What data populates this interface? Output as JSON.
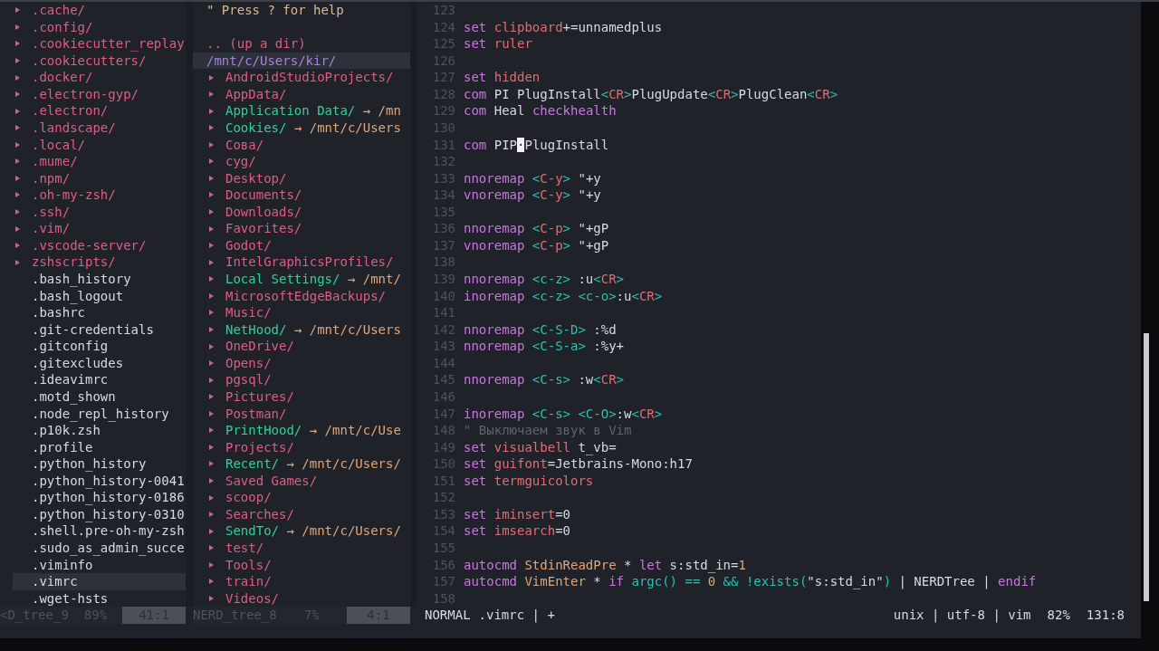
{
  "left_tree": {
    "items": [
      {
        "name": ".cache/",
        "kind": "dir",
        "selected": false
      },
      {
        "name": ".config/",
        "kind": "dir",
        "selected": false
      },
      {
        "name": ".cookiecutter_replay",
        "kind": "dir",
        "selected": false
      },
      {
        "name": ".cookiecutters/",
        "kind": "dir",
        "selected": false
      },
      {
        "name": ".docker/",
        "kind": "dir",
        "selected": false
      },
      {
        "name": ".electron-gyp/",
        "kind": "dir",
        "selected": false
      },
      {
        "name": ".electron/",
        "kind": "dir",
        "selected": false
      },
      {
        "name": ".landscape/",
        "kind": "dir",
        "selected": false
      },
      {
        "name": ".local/",
        "kind": "dir",
        "selected": false
      },
      {
        "name": ".mume/",
        "kind": "dir",
        "selected": false
      },
      {
        "name": ".npm/",
        "kind": "dir",
        "selected": false
      },
      {
        "name": ".oh-my-zsh/",
        "kind": "dir",
        "selected": false
      },
      {
        "name": ".ssh/",
        "kind": "dir",
        "selected": false
      },
      {
        "name": ".vim/",
        "kind": "dir",
        "selected": false
      },
      {
        "name": ".vscode-server/",
        "kind": "dir",
        "selected": false
      },
      {
        "name": "zshscripts/",
        "kind": "dir",
        "selected": false
      },
      {
        "name": ".bash_history",
        "kind": "file",
        "selected": false
      },
      {
        "name": ".bash_logout",
        "kind": "file",
        "selected": false
      },
      {
        "name": ".bashrc",
        "kind": "file",
        "selected": false
      },
      {
        "name": ".git-credentials",
        "kind": "file",
        "selected": false
      },
      {
        "name": ".gitconfig",
        "kind": "file",
        "selected": false
      },
      {
        "name": ".gitexcludes",
        "kind": "file",
        "selected": false
      },
      {
        "name": ".ideavimrc",
        "kind": "file",
        "selected": false
      },
      {
        "name": ".motd_shown",
        "kind": "file",
        "selected": false
      },
      {
        "name": ".node_repl_history",
        "kind": "file",
        "selected": false
      },
      {
        "name": ".p10k.zsh",
        "kind": "file",
        "selected": false
      },
      {
        "name": ".profile",
        "kind": "file",
        "selected": false
      },
      {
        "name": ".python_history",
        "kind": "file",
        "selected": false
      },
      {
        "name": ".python_history-0041",
        "kind": "file",
        "selected": false
      },
      {
        "name": ".python_history-0186",
        "kind": "file",
        "selected": false
      },
      {
        "name": ".python_history-0310",
        "kind": "file",
        "selected": false
      },
      {
        "name": ".shell.pre-oh-my-zsh",
        "kind": "file",
        "selected": false
      },
      {
        "name": ".sudo_as_admin_succe",
        "kind": "file",
        "selected": false
      },
      {
        "name": ".viminfo",
        "kind": "file",
        "selected": false
      },
      {
        "name": ".vimrc",
        "kind": "file",
        "selected": true
      },
      {
        "name": ".wget-hsts",
        "kind": "file",
        "selected": false
      }
    ],
    "status": {
      "buffer": "<D_tree_9",
      "percent": "89%",
      "position": "41:1"
    }
  },
  "middle_tree": {
    "help": "\" Press ? for help",
    "up_dir": ".. (up a dir)",
    "root": {
      "path": "/mnt/c/Users/kir/",
      "selected": true
    },
    "items": [
      {
        "name": "AndroidStudioProjects/",
        "kind": "dir",
        "selected": false
      },
      {
        "name": "AppData/",
        "kind": "dir",
        "selected": false
      },
      {
        "name": "Application Data/",
        "kind": "link",
        "target": "→ /mn",
        "selected": false
      },
      {
        "name": "Cookies/",
        "kind": "link",
        "target": "→ /mnt/c/Users",
        "selected": false
      },
      {
        "name": "Сова/",
        "kind": "dir",
        "selected": false
      },
      {
        "name": "cyg/",
        "kind": "dir",
        "selected": false
      },
      {
        "name": "Desktop/",
        "kind": "dir",
        "selected": false
      },
      {
        "name": "Documents/",
        "kind": "dir",
        "selected": false
      },
      {
        "name": "Downloads/",
        "kind": "dir",
        "selected": false
      },
      {
        "name": "Favorites/",
        "kind": "dir",
        "selected": false
      },
      {
        "name": "Godot/",
        "kind": "dir",
        "selected": false
      },
      {
        "name": "IntelGraphicsProfiles/",
        "kind": "dir",
        "selected": false
      },
      {
        "name": "Local Settings/",
        "kind": "link",
        "target": "→ /mnt/",
        "selected": false
      },
      {
        "name": "MicrosoftEdgeBackups/",
        "kind": "dir",
        "selected": false
      },
      {
        "name": "Music/",
        "kind": "dir",
        "selected": false
      },
      {
        "name": "NetHood/",
        "kind": "link",
        "target": "→ /mnt/c/Users",
        "selected": false
      },
      {
        "name": "OneDrive/",
        "kind": "dir",
        "selected": false
      },
      {
        "name": "Opens/",
        "kind": "dir",
        "selected": false
      },
      {
        "name": "pgsql/",
        "kind": "dir",
        "selected": false
      },
      {
        "name": "Pictures/",
        "kind": "dir",
        "selected": false
      },
      {
        "name": "Postman/",
        "kind": "dir",
        "selected": false
      },
      {
        "name": "PrintHood/",
        "kind": "link",
        "target": "→ /mnt/c/Use",
        "selected": false
      },
      {
        "name": "Projects/",
        "kind": "dir",
        "selected": false
      },
      {
        "name": "Recent/",
        "kind": "link",
        "target": "→ /mnt/c/Users/",
        "selected": false
      },
      {
        "name": "Saved Games/",
        "kind": "dir",
        "selected": false
      },
      {
        "name": "scoop/",
        "kind": "dir",
        "selected": false
      },
      {
        "name": "Searches/",
        "kind": "dir",
        "selected": false
      },
      {
        "name": "SendTo/",
        "kind": "link",
        "target": "→ /mnt/c/Users/",
        "selected": false
      },
      {
        "name": "test/",
        "kind": "dir",
        "selected": false
      },
      {
        "name": "Tools/",
        "kind": "dir",
        "selected": false
      },
      {
        "name": "train/",
        "kind": "dir",
        "selected": false
      },
      {
        "name": "Videos/",
        "kind": "dir",
        "selected": false
      }
    ],
    "status": {
      "buffer": "NERD_tree_8",
      "percent": "7%",
      "position": "4:1"
    }
  },
  "editor": {
    "lines": [
      {
        "number": "123"
      },
      {
        "number": "124",
        "tokens": [
          {
            "kind": "kw",
            "text": "set "
          },
          {
            "kind": "opt",
            "text": "clipboard"
          },
          {
            "kind": "plain",
            "text": "+=unnamedplus"
          }
        ]
      },
      {
        "number": "125",
        "tokens": [
          {
            "kind": "kw",
            "text": "set "
          },
          {
            "kind": "opt",
            "text": "ruler"
          }
        ]
      },
      {
        "number": "126"
      },
      {
        "number": "127",
        "tokens": [
          {
            "kind": "kw",
            "text": "set "
          },
          {
            "kind": "opt",
            "text": "hidden"
          }
        ]
      },
      {
        "number": "128",
        "tokens": [
          {
            "kind": "kw",
            "text": "com"
          },
          {
            "kind": "plain",
            "text": " PI PlugInstall"
          },
          {
            "kind": "sp",
            "text": "<"
          },
          {
            "kind": "sk",
            "text": "CR"
          },
          {
            "kind": "sp",
            "text": ">"
          },
          {
            "kind": "plain",
            "text": "PlugUpdate"
          },
          {
            "kind": "sp",
            "text": "<"
          },
          {
            "kind": "sk",
            "text": "CR"
          },
          {
            "kind": "sp",
            "text": ">"
          },
          {
            "kind": "plain",
            "text": "PlugClean"
          },
          {
            "kind": "sp",
            "text": "<"
          },
          {
            "kind": "sk",
            "text": "CR"
          },
          {
            "kind": "sp",
            "text": ">"
          }
        ]
      },
      {
        "number": "129",
        "tokens": [
          {
            "kind": "kw",
            "text": "com"
          },
          {
            "kind": "plain",
            "text": " Heal "
          },
          {
            "kind": "kw",
            "text": "checkhealth"
          }
        ]
      },
      {
        "number": "130"
      },
      {
        "number": "131",
        "tokens": [
          {
            "kind": "kw",
            "text": "com"
          },
          {
            "kind": "plain",
            "text": " PIP"
          },
          {
            "kind": "cursor",
            "text": "·"
          },
          {
            "kind": "plain",
            "text": "PlugInstall"
          }
        ]
      },
      {
        "number": "132"
      },
      {
        "number": "133",
        "tokens": [
          {
            "kind": "kw",
            "text": "nnoremap "
          },
          {
            "kind": "sp",
            "text": "<"
          },
          {
            "kind": "sk",
            "text": "C-y"
          },
          {
            "kind": "sp",
            "text": ">"
          },
          {
            "kind": "plain",
            "text": " \"+y"
          }
        ]
      },
      {
        "number": "134",
        "tokens": [
          {
            "kind": "kw",
            "text": "vnoremap "
          },
          {
            "kind": "sp",
            "text": "<"
          },
          {
            "kind": "sk",
            "text": "C-y"
          },
          {
            "kind": "sp",
            "text": ">"
          },
          {
            "kind": "plain",
            "text": " \"+y"
          }
        ]
      },
      {
        "number": "135"
      },
      {
        "number": "136",
        "tokens": [
          {
            "kind": "kw",
            "text": "nnoremap "
          },
          {
            "kind": "sp",
            "text": "<"
          },
          {
            "kind": "sk",
            "text": "C-p"
          },
          {
            "kind": "sp",
            "text": ">"
          },
          {
            "kind": "plain",
            "text": " \"+gP"
          }
        ]
      },
      {
        "number": "137",
        "tokens": [
          {
            "kind": "kw",
            "text": "vnoremap "
          },
          {
            "kind": "sp",
            "text": "<"
          },
          {
            "kind": "sk",
            "text": "C-p"
          },
          {
            "kind": "sp",
            "text": ">"
          },
          {
            "kind": "plain",
            "text": " \"+gP"
          }
        ]
      },
      {
        "number": "138"
      },
      {
        "number": "139",
        "tokens": [
          {
            "kind": "kw",
            "text": "nnoremap "
          },
          {
            "kind": "sp",
            "text": "<c-z>"
          },
          {
            "kind": "plain",
            "text": " :u"
          },
          {
            "kind": "sp",
            "text": "<"
          },
          {
            "kind": "sk",
            "text": "CR"
          },
          {
            "kind": "sp",
            "text": ">"
          }
        ]
      },
      {
        "number": "140",
        "tokens": [
          {
            "kind": "kw",
            "text": "inoremap "
          },
          {
            "kind": "sp",
            "text": "<c-z> <c-o>"
          },
          {
            "kind": "plain",
            "text": ":u"
          },
          {
            "kind": "sp",
            "text": "<"
          },
          {
            "kind": "sk",
            "text": "CR"
          },
          {
            "kind": "sp",
            "text": ">"
          }
        ]
      },
      {
        "number": "141"
      },
      {
        "number": "142",
        "tokens": [
          {
            "kind": "kw",
            "text": "nnoremap "
          },
          {
            "kind": "sp",
            "text": "<C-S-D>"
          },
          {
            "kind": "plain",
            "text": " :%d"
          }
        ]
      },
      {
        "number": "143",
        "tokens": [
          {
            "kind": "kw",
            "text": "nnoremap "
          },
          {
            "kind": "sp",
            "text": "<C-S-a>"
          },
          {
            "kind": "plain",
            "text": " :%y+"
          }
        ]
      },
      {
        "number": "144"
      },
      {
        "number": "145",
        "tokens": [
          {
            "kind": "kw",
            "text": "nnoremap "
          },
          {
            "kind": "sp",
            "text": "<C-s>"
          },
          {
            "kind": "plain",
            "text": " :w"
          },
          {
            "kind": "sp",
            "text": "<"
          },
          {
            "kind": "sk",
            "text": "CR"
          },
          {
            "kind": "sp",
            "text": ">"
          }
        ]
      },
      {
        "number": "146"
      },
      {
        "number": "147",
        "tokens": [
          {
            "kind": "kw",
            "text": "inoremap "
          },
          {
            "kind": "sp",
            "text": "<C-s> <C-O>"
          },
          {
            "kind": "plain",
            "text": ":w"
          },
          {
            "kind": "sp",
            "text": "<"
          },
          {
            "kind": "sk",
            "text": "CR"
          },
          {
            "kind": "sp",
            "text": ">"
          }
        ]
      },
      {
        "number": "148",
        "tokens": [
          {
            "kind": "comment",
            "text": "\" Выключаем звук в Vim"
          }
        ]
      },
      {
        "number": "149",
        "tokens": [
          {
            "kind": "kw",
            "text": "set "
          },
          {
            "kind": "opt",
            "text": "visualbell"
          },
          {
            "kind": "plain",
            "text": " t_vb="
          }
        ]
      },
      {
        "number": "150",
        "tokens": [
          {
            "kind": "kw",
            "text": "set "
          },
          {
            "kind": "opt",
            "text": "guifont"
          },
          {
            "kind": "plain",
            "text": "=Jetbrains-Mono:h17"
          }
        ]
      },
      {
        "number": "151",
        "tokens": [
          {
            "kind": "kw",
            "text": "set "
          },
          {
            "kind": "opt",
            "text": "termguicolors"
          }
        ]
      },
      {
        "number": "152"
      },
      {
        "number": "153",
        "tokens": [
          {
            "kind": "kw",
            "text": "set "
          },
          {
            "kind": "opt",
            "text": "iminsert"
          },
          {
            "kind": "plain",
            "text": "=0"
          }
        ]
      },
      {
        "number": "154",
        "tokens": [
          {
            "kind": "kw",
            "text": "set "
          },
          {
            "kind": "opt",
            "text": "imsearch"
          },
          {
            "kind": "plain",
            "text": "=0"
          }
        ]
      },
      {
        "number": "155"
      },
      {
        "number": "156",
        "tokens": [
          {
            "kind": "kw",
            "text": "autocmd "
          },
          {
            "kind": "fn",
            "text": "StdinReadPre"
          },
          {
            "kind": "plain",
            "text": " * "
          },
          {
            "kind": "kw",
            "text": "let"
          },
          {
            "kind": "plain",
            "text": " s:std_in="
          },
          {
            "kind": "num",
            "text": "1"
          }
        ]
      },
      {
        "number": "157",
        "tokens": [
          {
            "kind": "kw",
            "text": "autocmd "
          },
          {
            "kind": "fn",
            "text": "VimEnter"
          },
          {
            "kind": "plain",
            "text": " * "
          },
          {
            "kind": "kw",
            "text": "if"
          },
          {
            "kind": "sp",
            "text": " argc() == "
          },
          {
            "kind": "num",
            "text": "0"
          },
          {
            "kind": "sp",
            "text": " && !exists("
          },
          {
            "kind": "plain",
            "text": "\"s:std_in\""
          },
          {
            "kind": "sp",
            "text": ")"
          },
          {
            "kind": "plain",
            "text": " | NERDTree | "
          },
          {
            "kind": "kw",
            "text": "endif"
          }
        ]
      },
      {
        "number": "158"
      }
    ],
    "status": {
      "mode": "NORMAL",
      "file": ".vimrc | +",
      "info": "unix | utf-8 | vim",
      "percent": "82%",
      "position": "131:8"
    }
  }
}
